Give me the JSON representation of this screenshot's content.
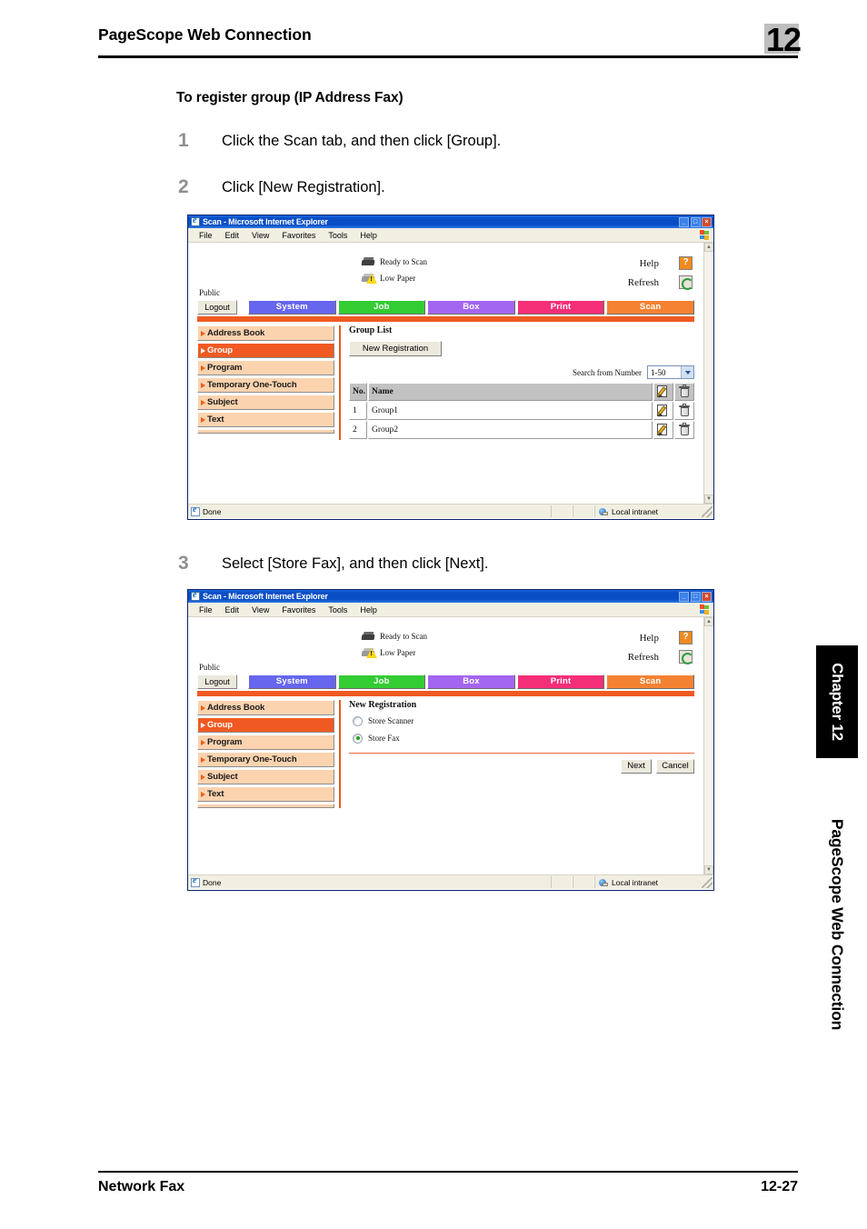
{
  "page": {
    "header_title": "PageScope Web Connection",
    "chapter_number": "12",
    "footer_left": "Network Fax",
    "footer_page": "12-27",
    "side_tab_chapter": "Chapter 12",
    "side_tab_book": "PageScope Web Connection"
  },
  "section": {
    "title": "To register group (IP Address Fax)",
    "steps": [
      {
        "num": "1",
        "text": "Click the Scan tab, and then click [Group]."
      },
      {
        "num": "2",
        "text": "Click [New Registration]."
      },
      {
        "num": "3",
        "text": "Select [Store Fax], and then click [Next]."
      }
    ]
  },
  "browser": {
    "title": "Scan - Microsoft Internet Explorer",
    "menu": [
      "File",
      "Edit",
      "View",
      "Favorites",
      "Tools",
      "Help"
    ],
    "win_buttons": {
      "minimize": "_",
      "maximize": "□",
      "close": "×"
    },
    "status_done": "Done",
    "status_zone": "Local intranet"
  },
  "app": {
    "device_status": [
      {
        "label": "Ready to Scan",
        "icon": "printer-icon"
      },
      {
        "label": "Low Paper",
        "icon": "printer-warning-icon"
      }
    ],
    "help_label": "Help",
    "refresh_label": "Refresh",
    "user_label": "Public",
    "logout_label": "Logout",
    "tabs": [
      {
        "label": "System",
        "color": "#6666ee"
      },
      {
        "label": "Job",
        "color": "#33cc33"
      },
      {
        "label": "Box",
        "color": "#a366f0"
      },
      {
        "label": "Print",
        "color": "#f52e78"
      },
      {
        "label": "Scan",
        "color": "#f58232",
        "selected": true
      }
    ],
    "accent_color": "#f05a22",
    "nav_items": [
      {
        "label": "Address Book",
        "selected": false
      },
      {
        "label": "Group",
        "selected": true
      },
      {
        "label": "Program",
        "selected": false
      },
      {
        "label": "Temporary One-Touch",
        "selected": false
      },
      {
        "label": "Subject",
        "selected": false
      },
      {
        "label": "Text",
        "selected": false
      }
    ]
  },
  "screen_group_list": {
    "pane_title": "Group List",
    "new_registration_label": "New Registration",
    "search_label": "Search from Number",
    "search_value": "1-50",
    "table": {
      "headers": [
        "No.",
        "Name"
      ],
      "rows": [
        {
          "no": "1",
          "name": "Group1"
        },
        {
          "no": "2",
          "name": "Group2"
        }
      ]
    }
  },
  "screen_new_registration": {
    "pane_title": "New Registration",
    "options": [
      {
        "label": "Store Scanner",
        "selected": false
      },
      {
        "label": "Store Fax",
        "selected": true
      }
    ],
    "next_label": "Next",
    "cancel_label": "Cancel"
  }
}
